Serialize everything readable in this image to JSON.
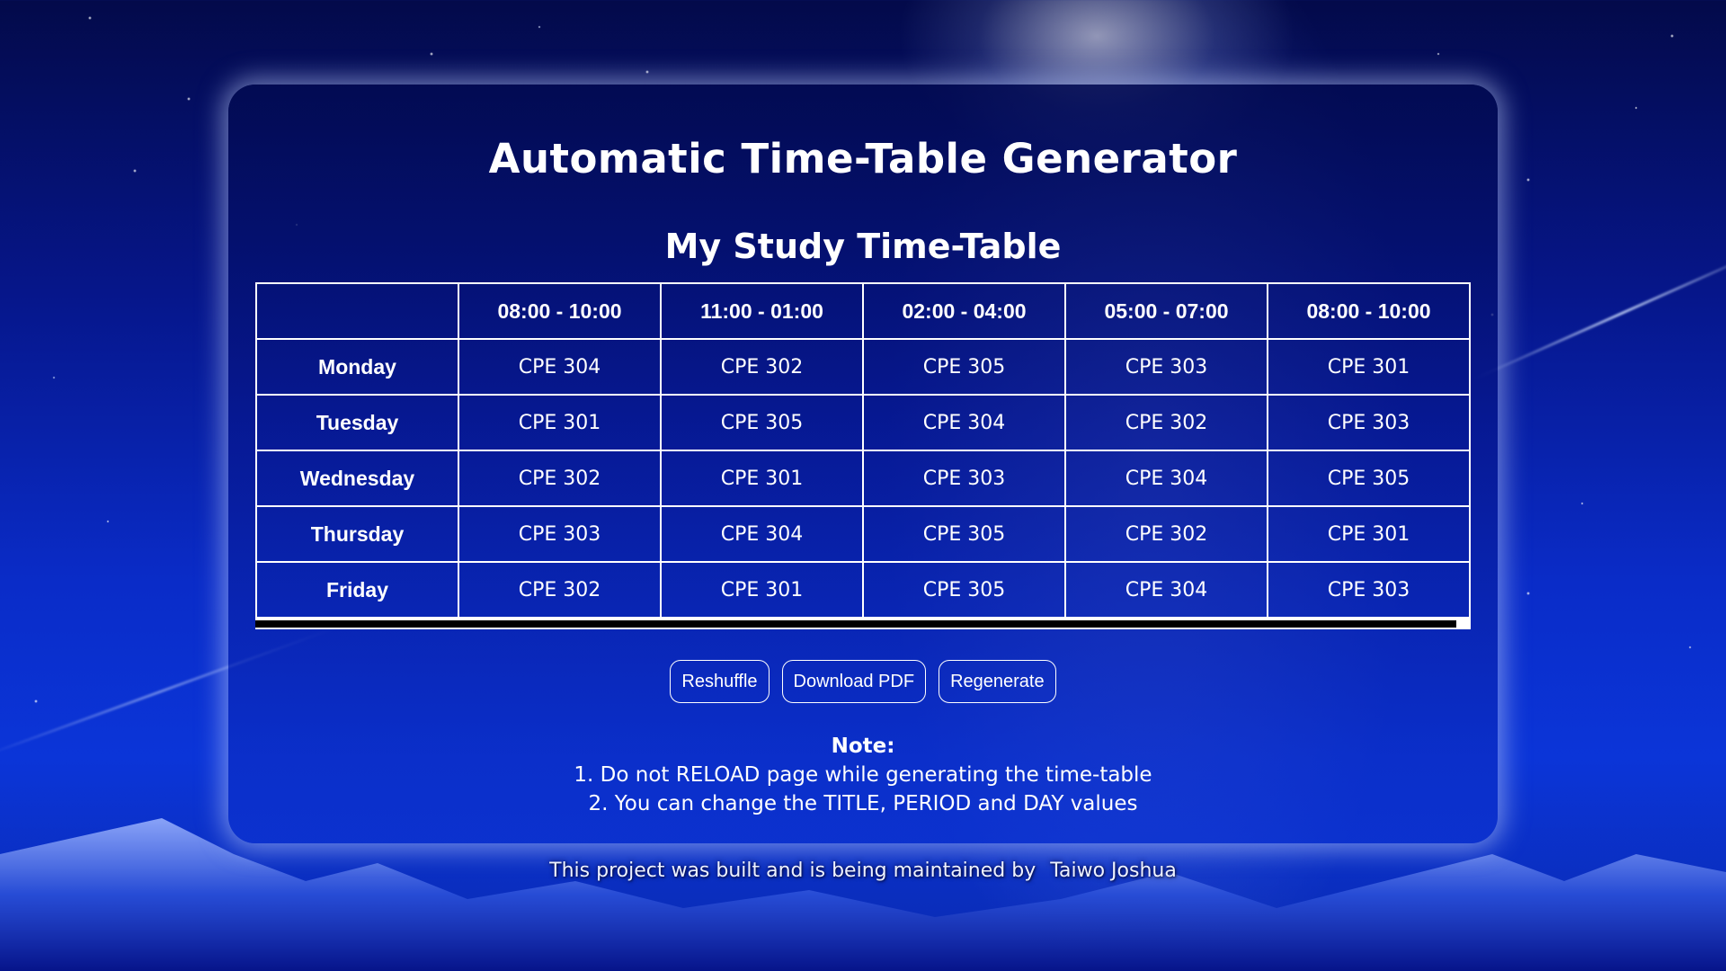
{
  "app": {
    "title": "Automatic Time-Table Generator",
    "table_title": "My Study Time-Table"
  },
  "table": {
    "corner": "",
    "periods": [
      "08:00 - 10:00",
      "11:00 - 01:00",
      "02:00 - 04:00",
      "05:00 - 07:00",
      "08:00 - 10:00"
    ],
    "rows": [
      {
        "day": "Monday",
        "cells": [
          "CPE 304",
          "CPE 302",
          "CPE 305",
          "CPE 303",
          "CPE 301"
        ]
      },
      {
        "day": "Tuesday",
        "cells": [
          "CPE 301",
          "CPE 305",
          "CPE 304",
          "CPE 302",
          "CPE 303"
        ]
      },
      {
        "day": "Wednesday",
        "cells": [
          "CPE 302",
          "CPE 301",
          "CPE 303",
          "CPE 304",
          "CPE 305"
        ]
      },
      {
        "day": "Thursday",
        "cells": [
          "CPE 303",
          "CPE 304",
          "CPE 305",
          "CPE 302",
          "CPE 301"
        ]
      },
      {
        "day": "Friday",
        "cells": [
          "CPE 302",
          "CPE 301",
          "CPE 305",
          "CPE 304",
          "CPE 303"
        ]
      }
    ]
  },
  "actions": {
    "reshuffle": "Reshuffle",
    "download_pdf": "Download PDF",
    "regenerate": "Regenerate"
  },
  "note": {
    "title": "Note:",
    "line1": "1. Do not RELOAD page while generating the time-table",
    "line2": "2. You can change the TITLE, PERIOD and DAY values"
  },
  "footer": {
    "text": "This project was built and is being maintained by",
    "author": "Taiwo Joshua"
  },
  "colors": {
    "card_border_glow": "#c8d7ff",
    "text": "#ffffff",
    "background_top": "#030a4a",
    "background_bottom": "#0b35d8"
  }
}
